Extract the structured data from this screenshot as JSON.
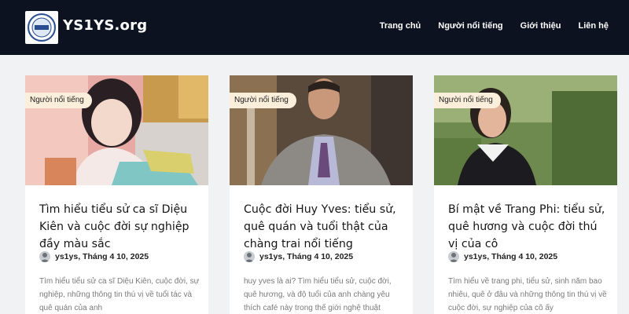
{
  "site": {
    "title": "YS1YS.org",
    "logo_label": "logo"
  },
  "nav": {
    "items": [
      {
        "label": "Trang chủ"
      },
      {
        "label": "Người nổi tiếng"
      },
      {
        "label": "Giới thiệu"
      },
      {
        "label": "Liên hệ"
      }
    ]
  },
  "posts": [
    {
      "category": "Người nổi tiếng",
      "title": "Tìm hiểu tiểu sử ca sĩ Diệu Kiên và cuộc đời sự nghiệp đầy màu sắc",
      "author": "ys1ys",
      "date": "Tháng 4 10, 2025",
      "excerpt": "Tìm hiểu tiểu sử ca sĩ Diệu Kiên, cuộc đời, sự nghiệp, những thông tin thú vị về tuổi tác và quê quán của anh"
    },
    {
      "category": "Người nổi tiếng",
      "title": "Cuộc đời Huy Yves: tiểu sử, quê quán và tuổi thật của chàng trai nổi tiếng",
      "author": "ys1ys",
      "date": "Tháng 4 10, 2025",
      "excerpt": "huy yves là ai? Tìm hiểu tiểu sử, cuộc đời, quê hương, và độ tuổi của anh chàng yêu thích café này trong thế giới nghệ thuật"
    },
    {
      "category": "Người nổi tiếng",
      "title": "Bí mật về Trang Phi: tiểu sử, quê hương và cuộc đời thú vị của cô",
      "author": "ys1ys",
      "date": "Tháng 4 10, 2025",
      "excerpt": "Tìm hiểu về trang phi, tiểu sử, sinh năm bao nhiêu, quê ở đâu và những thông tin thú vị về cuộc đời, sự nghiệp của cô ấy"
    }
  ],
  "colors": {
    "header_bg": "#0c1220",
    "page_bg": "#f1f2f4",
    "badge_bg": "#fbefdc"
  }
}
